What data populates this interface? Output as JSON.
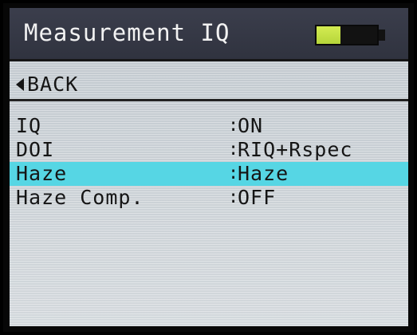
{
  "header": {
    "title": "Measurement IQ",
    "battery_icon": "battery-icon",
    "battery_level": 0.4,
    "battery_color": "#c8e24a"
  },
  "back": {
    "label": "BACK",
    "icon": "left-arrow-icon"
  },
  "menu": {
    "separator": ":",
    "items": [
      {
        "label": "IQ",
        "value": "ON",
        "selected": false
      },
      {
        "label": "DOI",
        "value": "RIQ+Rspec",
        "selected": false
      },
      {
        "label": "Haze",
        "value": "Haze",
        "selected": true
      },
      {
        "label": "Haze Comp.",
        "value": "OFF",
        "selected": false
      }
    ],
    "highlight_color": "#56d6e4"
  }
}
